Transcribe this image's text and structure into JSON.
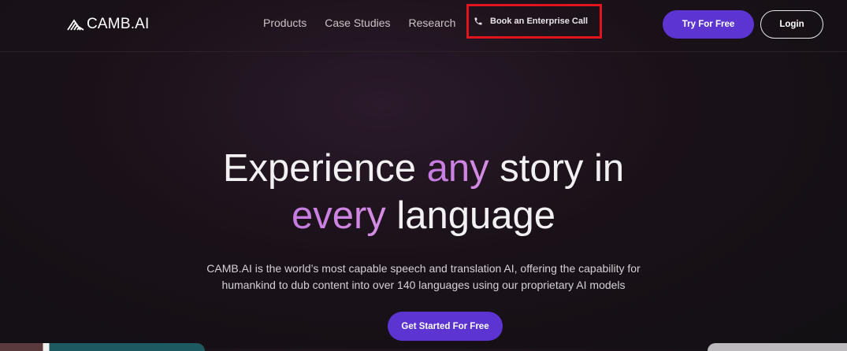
{
  "header": {
    "logo_text": "CAMB.AI",
    "nav_links": [
      "Products",
      "Case Studies",
      "Research"
    ],
    "enterprise_call": "Book an Enterprise Call",
    "try_button": "Try For Free",
    "login_button": "Login"
  },
  "hero": {
    "title_line1_a": "Experience ",
    "title_line1_accent": "any",
    "title_line1_b": " story in",
    "title_line2_accent": "every",
    "title_line2_b": " language",
    "subtitle_line1": "CAMB.AI is the world’s most capable speech and translation AI, offering the capability for",
    "subtitle_line2": "humankind to dub content into over 140 languages using our proprietary AI models",
    "cta_button": "Get Started For Free"
  },
  "colors": {
    "primary_button": "#5b34d1",
    "accent_text": "#c47ae0",
    "highlight_box": "#e0141d"
  },
  "icons": [
    "camb-logo-icon",
    "phone-icon"
  ]
}
